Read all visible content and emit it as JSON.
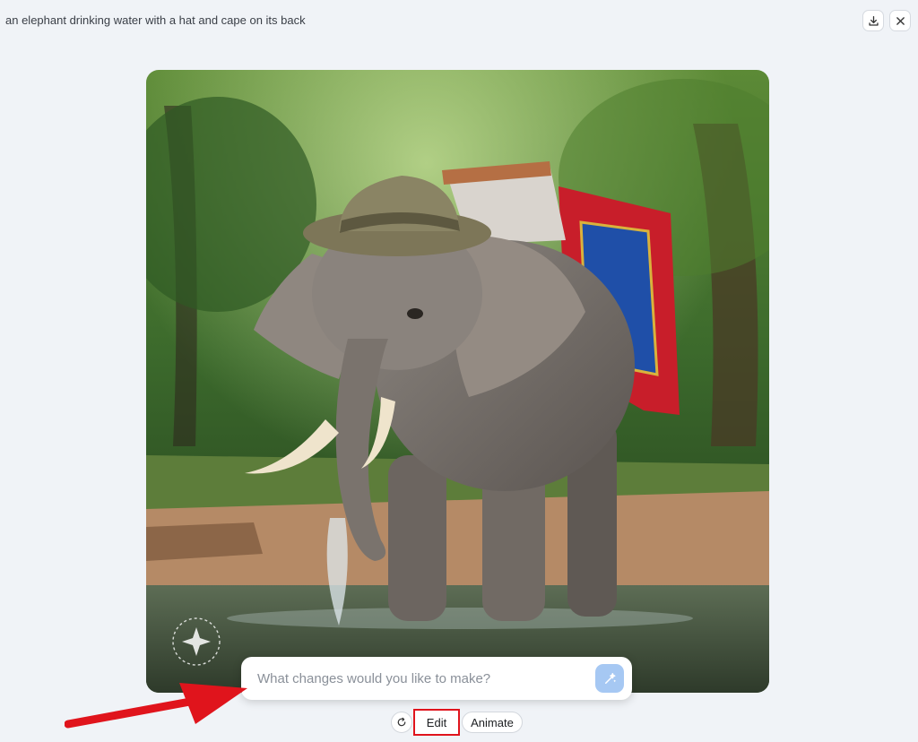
{
  "header": {
    "prompt": "an elephant drinking water with a hat and cape on its back",
    "download_icon": "download-icon",
    "close_icon": "close-icon"
  },
  "image": {
    "subject": "elephant wearing hat and saddle with red cape drinking water",
    "watermark_icon": "imagine-watermark-icon"
  },
  "edit_box": {
    "placeholder": "What changes would you like to make?",
    "submit_icon": "magic-edit-icon"
  },
  "actions": {
    "regenerate_icon": "refresh-icon",
    "edit_label": "Edit",
    "animate_label": "Animate"
  },
  "annotation": {
    "arrow_color": "#e0141c",
    "highlight_color": "#e0141c"
  }
}
